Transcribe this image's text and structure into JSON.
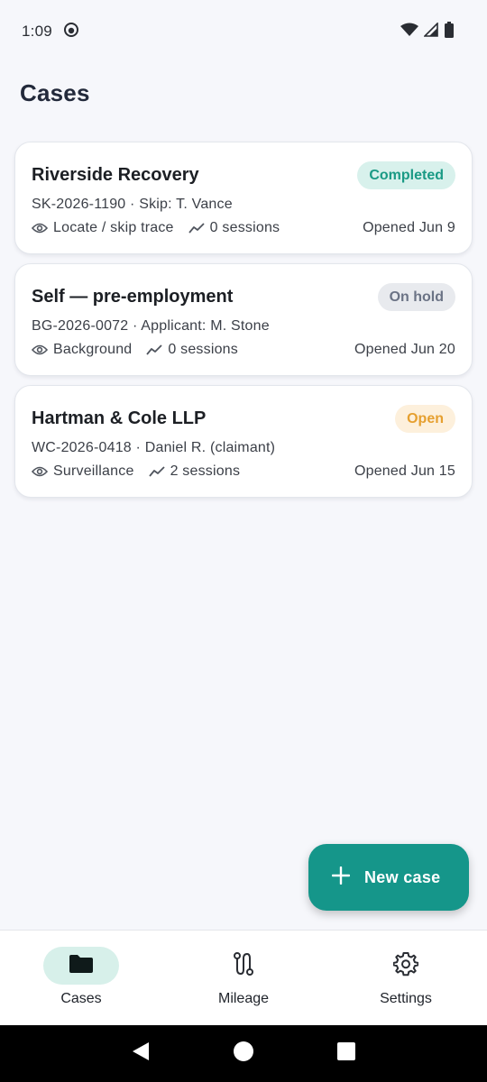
{
  "status_bar": {
    "time": "1:09"
  },
  "page": {
    "title": "Cases"
  },
  "cases": [
    {
      "title": "Riverside Recovery",
      "status": "Completed",
      "subtitle": "SK-2026-1190 · Skip: T. Vance",
      "type": "Locate / skip trace",
      "sessions": "0 sessions",
      "opened": "Opened Jun 9"
    },
    {
      "title": "Self — pre-employment",
      "status": "On hold",
      "subtitle": "BG-2026-0072 · Applicant: M. Stone",
      "type": "Background",
      "sessions": "0 sessions",
      "opened": "Opened Jun 20"
    },
    {
      "title": "Hartman & Cole LLP",
      "status": "Open",
      "subtitle": "WC-2026-0418 · Daniel R. (claimant)",
      "type": "Surveillance",
      "sessions": "2 sessions",
      "opened": "Opened Jun 15"
    }
  ],
  "fab": {
    "label": "New case",
    "icon": "plus-icon"
  },
  "bottom_nav": {
    "items": [
      {
        "label": "Cases",
        "icon": "folder-icon",
        "active": true
      },
      {
        "label": "Mileage",
        "icon": "route-icon",
        "active": false
      },
      {
        "label": "Settings",
        "icon": "gear-icon",
        "active": false
      }
    ]
  },
  "colors": {
    "accent": "#15968a",
    "completed_bg": "#d8f1ec",
    "completed_fg": "#1a9a85",
    "onhold_bg": "#e8eaee",
    "onhold_fg": "#6b7385",
    "open_bg": "#fdf0dc",
    "open_fg": "#e6a030"
  }
}
